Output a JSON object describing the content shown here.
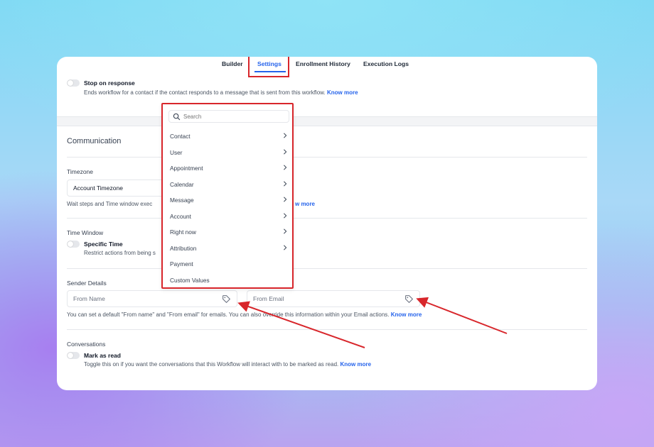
{
  "tabs": {
    "builder": "Builder",
    "settings": "Settings",
    "enrollment": "Enrollment History",
    "execution": "Execution Logs"
  },
  "stop_on_response": {
    "title": "Stop on response",
    "desc": "Ends workflow for a contact if the contact responds to a message that is sent from this workflow.",
    "link": "Know more"
  },
  "communication": {
    "title": "Communication",
    "timezone": {
      "label": "Timezone",
      "value": "Account Timezone",
      "help": "Wait steps and Time window exec",
      "link": "w more"
    },
    "time_window": {
      "label": "Time Window",
      "toggle_label": "Specific Time",
      "desc": "Restrict actions from being s"
    },
    "sender": {
      "label": "Sender Details",
      "from_name_placeholder": "From Name",
      "from_email_placeholder": "From Email",
      "help": "You can set a default \"From name\" and \"From email\" for emails. You can also override this information within your Email actions.",
      "link": "Know more"
    },
    "conversations": {
      "label": "Conversations",
      "toggle_label": "Mark as read",
      "desc": "Toggle this on if you want the conversations that this Workflow will interact with to be marked as read.",
      "link": "Know more"
    }
  },
  "dropdown": {
    "search_placeholder": "Search",
    "items": [
      {
        "label": "Contact"
      },
      {
        "label": "User"
      },
      {
        "label": "Appointment"
      },
      {
        "label": "Calendar"
      },
      {
        "label": "Message"
      },
      {
        "label": "Account"
      },
      {
        "label": "Right now"
      },
      {
        "label": "Attribution"
      },
      {
        "label": "Payment"
      },
      {
        "label": "Custom Values"
      }
    ]
  },
  "colors": {
    "accent": "#2563eb",
    "highlight": "#d8262b"
  }
}
